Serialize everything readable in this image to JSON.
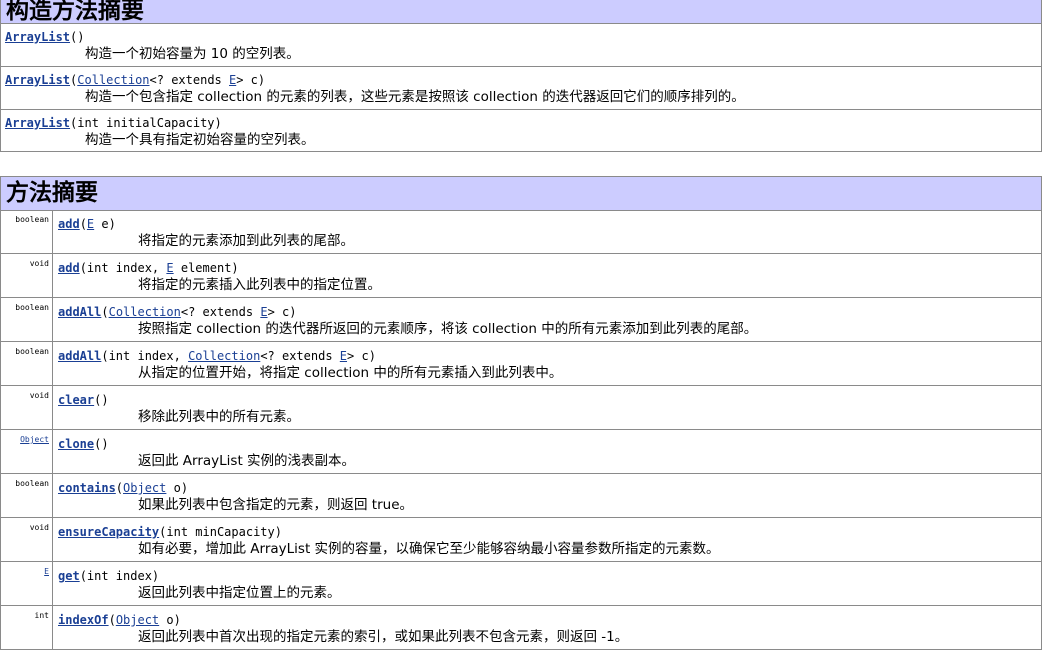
{
  "constructor_summary": {
    "title": "构造方法摘要",
    "rows": [
      {
        "name": "ArrayList",
        "params": [
          "()"
        ],
        "description": "构造一个初始容量为 10 的空列表。"
      },
      {
        "name": "ArrayList",
        "params": [
          "(",
          "Collection",
          "<? extends ",
          "E",
          "> c)"
        ],
        "description": "构造一个包含指定 collection 的元素的列表，这些元素是按照该 collection 的迭代器返回它们的顺序排列的。"
      },
      {
        "name": "ArrayList",
        "params": [
          "(int initialCapacity)"
        ],
        "description": "构造一个具有指定初始容量的空列表。"
      }
    ]
  },
  "method_summary": {
    "title": "方法摘要",
    "rows": [
      {
        "type": "boolean",
        "name": "add",
        "sig_a": "(",
        "sig_b": "E",
        "sig_c": " e)",
        "description": "将指定的元素添加到此列表的尾部。"
      },
      {
        "type": "void",
        "name": "add",
        "sig_a": "(int index, ",
        "sig_b": "E",
        "sig_c": " element)",
        "description": "将指定的元素插入此列表中的指定位置。"
      },
      {
        "type": "boolean",
        "name": "addAll",
        "sig_a": "(",
        "sig_b": "Collection",
        "sig_c": "<? extends ",
        "sig_d": "E",
        "sig_e": "> c)",
        "description": "按照指定 collection 的迭代器所返回的元素顺序，将该 collection 中的所有元素添加到此列表的尾部。"
      },
      {
        "type": "boolean",
        "name": "addAll",
        "sig_a": "(int index, ",
        "sig_b": "Collection",
        "sig_c": "<? extends ",
        "sig_d": "E",
        "sig_e": "> c)",
        "description": "从指定的位置开始，将指定 collection 中的所有元素插入到此列表中。"
      },
      {
        "type": "void",
        "name": "clear",
        "sig_a": "()",
        "description": "移除此列表中的所有元素。"
      },
      {
        "type": "Object",
        "name": "clone",
        "sig_a": "()",
        "description": "返回此 ArrayList 实例的浅表副本。"
      },
      {
        "type": "boolean",
        "name": "contains",
        "sig_a": "(",
        "sig_b": "Object",
        "sig_c": " o)",
        "description": "如果此列表中包含指定的元素，则返回 true。"
      },
      {
        "type": "void",
        "name": "ensureCapacity",
        "sig_a": "(int minCapacity)",
        "description": "如有必要，增加此 ArrayList 实例的容量，以确保它至少能够容纳最小容量参数所指定的元素数。"
      },
      {
        "type": "E",
        "name": "get",
        "sig_a": "(int index)",
        "description": "返回此列表中指定位置上的元素。"
      },
      {
        "type": "int",
        "name": "indexOf",
        "sig_a": "(",
        "sig_b": "Object",
        "sig_c": " o)",
        "description": "返回此列表中首次出现的指定元素的索引，或如果此列表不包含元素，则返回 -1。"
      }
    ]
  },
  "colors": {
    "header_bg": "#ccccff",
    "link": "#1a3f94",
    "border": "#8a8a8a"
  }
}
